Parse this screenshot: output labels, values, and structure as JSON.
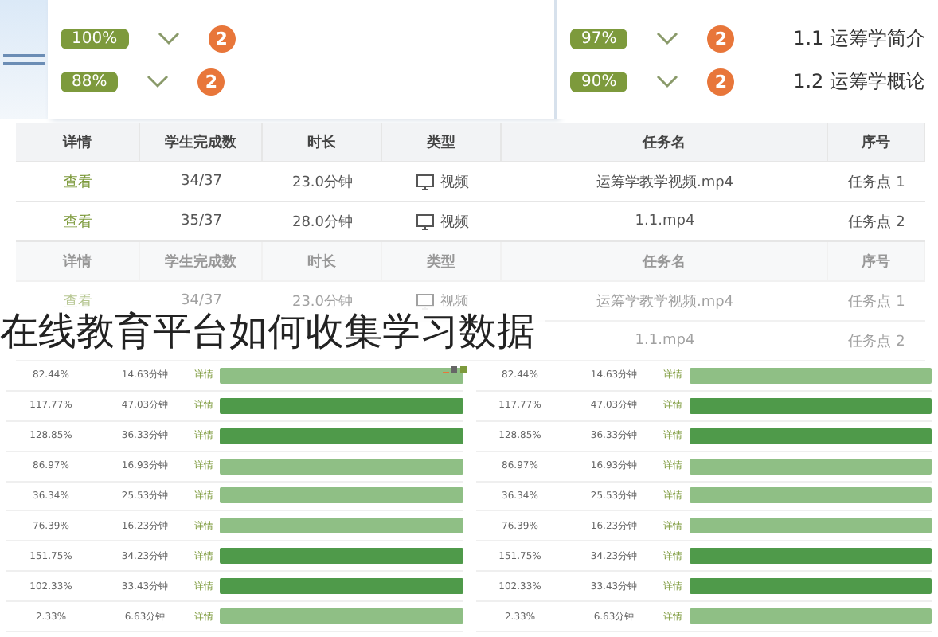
{
  "chapters_left": [
    {
      "percent": "100%",
      "count": "2"
    },
    {
      "percent": "88%",
      "count": "2"
    }
  ],
  "chapters_right": [
    {
      "percent": "97%",
      "count": "2",
      "title": "1.1 运筹学简介"
    },
    {
      "percent": "90%",
      "count": "2",
      "title": "1.2 运筹学概论"
    }
  ],
  "table": {
    "columns": [
      "详情",
      "学生完成数",
      "时长",
      "类型",
      "任务名",
      "序号"
    ],
    "rows": [
      [
        "查看",
        "34/37",
        "23.0分钟",
        "视频",
        "运筹学教学视频.mp4",
        "任务点 1"
      ],
      [
        "查看",
        "35/37",
        "28.0分钟",
        "视频",
        "1.1.mp4",
        "任务点 2"
      ]
    ]
  },
  "table_faded": {
    "columns": [
      "详情",
      "学生完成数",
      "时长",
      "类型",
      "任务名",
      "序号"
    ],
    "rows": [
      [
        "查看",
        "34/37",
        "23.0分钟",
        "视频",
        "运筹学教学视频.mp4",
        "任务点 1"
      ],
      [
        null,
        null,
        null,
        null,
        "1.1.mp4",
        "任务点 2"
      ]
    ]
  },
  "caption": "在线教育平台如何收集学习数据",
  "stats_left": [
    {
      "rate": "82.44%",
      "time": "14.63分钟",
      "label": "详情",
      "dark": false
    },
    {
      "rate": "117.77%",
      "time": "47.03分钟",
      "label": "详情",
      "dark": true
    },
    {
      "rate": "128.85%",
      "time": "36.33分钟",
      "label": "详情",
      "dark": true
    },
    {
      "rate": "86.97%",
      "time": "16.93分钟",
      "label": "详情",
      "dark": false
    },
    {
      "rate": "36.34%",
      "time": "25.53分钟",
      "label": "详情",
      "dark": false
    },
    {
      "rate": "76.39%",
      "time": "16.23分钟",
      "label": "详情",
      "dark": false
    },
    {
      "rate": "151.75%",
      "time": "34.23分钟",
      "label": "详情",
      "dark": true
    },
    {
      "rate": "102.33%",
      "time": "33.43分钟",
      "label": "详情",
      "dark": true
    },
    {
      "rate": "2.33%",
      "time": "6.63分钟",
      "label": "详情",
      "dark": false
    }
  ],
  "stats_right": [
    {
      "rate": "82.44%",
      "time": "14.63分钟",
      "label": "详情",
      "dark": false
    },
    {
      "rate": "117.77%",
      "time": "47.03分钟",
      "label": "详情",
      "dark": true
    },
    {
      "rate": "128.85%",
      "time": "36.33分钟",
      "label": "详情",
      "dark": true
    },
    {
      "rate": "86.97%",
      "time": "16.93分钟",
      "label": "详情",
      "dark": false
    },
    {
      "rate": "36.34%",
      "time": "25.53分钟",
      "label": "详情",
      "dark": false
    },
    {
      "rate": "76.39%",
      "time": "16.23分钟",
      "label": "详情",
      "dark": false
    },
    {
      "rate": "151.75%",
      "time": "34.23分钟",
      "label": "详情",
      "dark": true
    },
    {
      "rate": "102.33%",
      "time": "33.43分钟",
      "label": "详情",
      "dark": true
    },
    {
      "rate": "2.33%",
      "time": "6.63分钟",
      "label": "详情",
      "dark": false
    }
  ]
}
